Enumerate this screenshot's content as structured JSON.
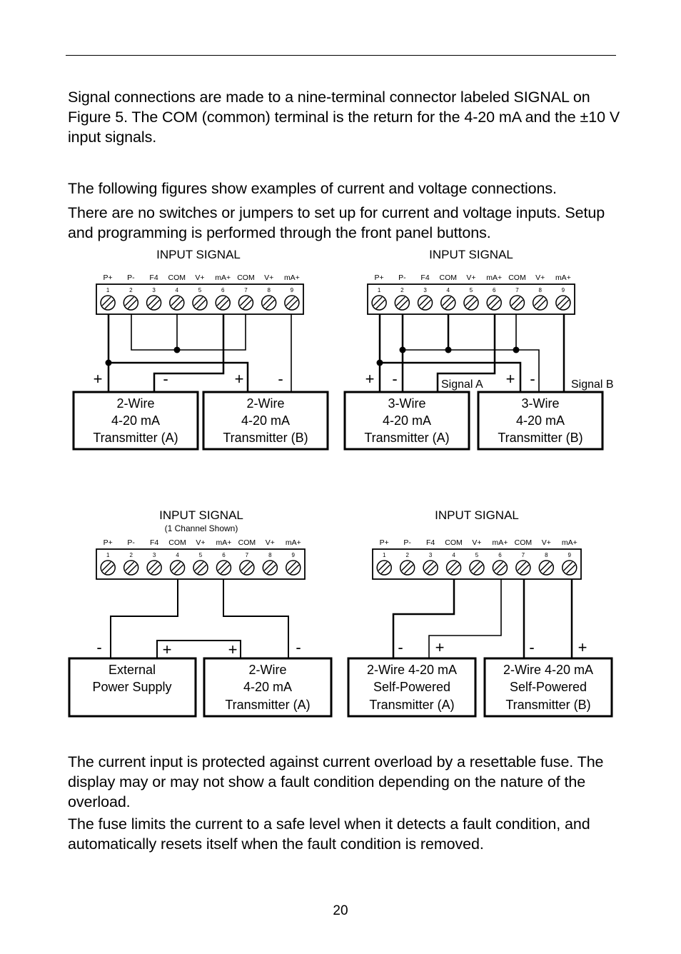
{
  "page": {
    "paragraphs": [
      "Signal connections are made to a nine-terminal connector labeled SIGNAL on Figure 5. The COM (common) terminal is the return for the 4-20 mA and the ±10 V input signals.",
      "The following figures show examples of current and voltage connections.",
      "There are no switches or jumpers to set up for current and voltage inputs. Setup and programming is performed through the front panel buttons.",
      "The current input is protected against current overload by a resettable fuse. The display may or may not show a fault condition depending on the nature of the overload.",
      "The fuse limits the current to a safe level when it detects a fault condition, and automatically resets itself when the fault condition is removed."
    ],
    "page_number": "20"
  },
  "terminals": {
    "labels": [
      "P+",
      "P-",
      "F4",
      "COM",
      "V+",
      "mA+",
      "COM",
      "V+",
      "mA+"
    ],
    "numbers": [
      "1",
      "2",
      "3",
      "4",
      "5",
      "6",
      "7",
      "8",
      "9"
    ]
  },
  "diagrams": [
    {
      "title": "INPUT SIGNAL",
      "subtitle": "",
      "devices": [
        {
          "lines": [
            "2-Wire",
            "4-20 mA",
            "Transmitter (A)"
          ]
        },
        {
          "lines": [
            "2-Wire",
            "4-20 mA",
            "Transmitter (B)"
          ]
        }
      ],
      "polarity": [
        "+",
        "-",
        "+",
        "-"
      ]
    },
    {
      "title": "INPUT SIGNAL",
      "subtitle": "",
      "devices": [
        {
          "lines": [
            "3-Wire",
            "4-20 mA",
            "Transmitter (A)"
          ]
        },
        {
          "lines": [
            "3-Wire",
            "4-20 mA",
            "Transmitter (B)"
          ]
        }
      ],
      "polarity": [
        "+",
        "-",
        "+",
        "-"
      ],
      "signal_labels": [
        "Signal A",
        "Signal B"
      ]
    },
    {
      "title": "INPUT SIGNAL",
      "subtitle": "(1 Channel Shown)",
      "devices": [
        {
          "lines": [
            "External",
            "Power Supply"
          ]
        },
        {
          "lines": [
            "2-Wire",
            "4-20 mA",
            "Transmitter (A)"
          ]
        }
      ],
      "polarity": [
        "-",
        "+",
        "+",
        "-"
      ]
    },
    {
      "title": "INPUT SIGNAL",
      "subtitle": "",
      "devices": [
        {
          "lines": [
            "2-Wire 4-20 mA",
            "Self-Powered",
            "Transmitter (A)"
          ]
        },
        {
          "lines": [
            "2-Wire 4-20 mA",
            "Self-Powered",
            "Transmitter (B)"
          ]
        }
      ],
      "polarity": [
        "-",
        "+",
        "-",
        "+"
      ]
    }
  ]
}
